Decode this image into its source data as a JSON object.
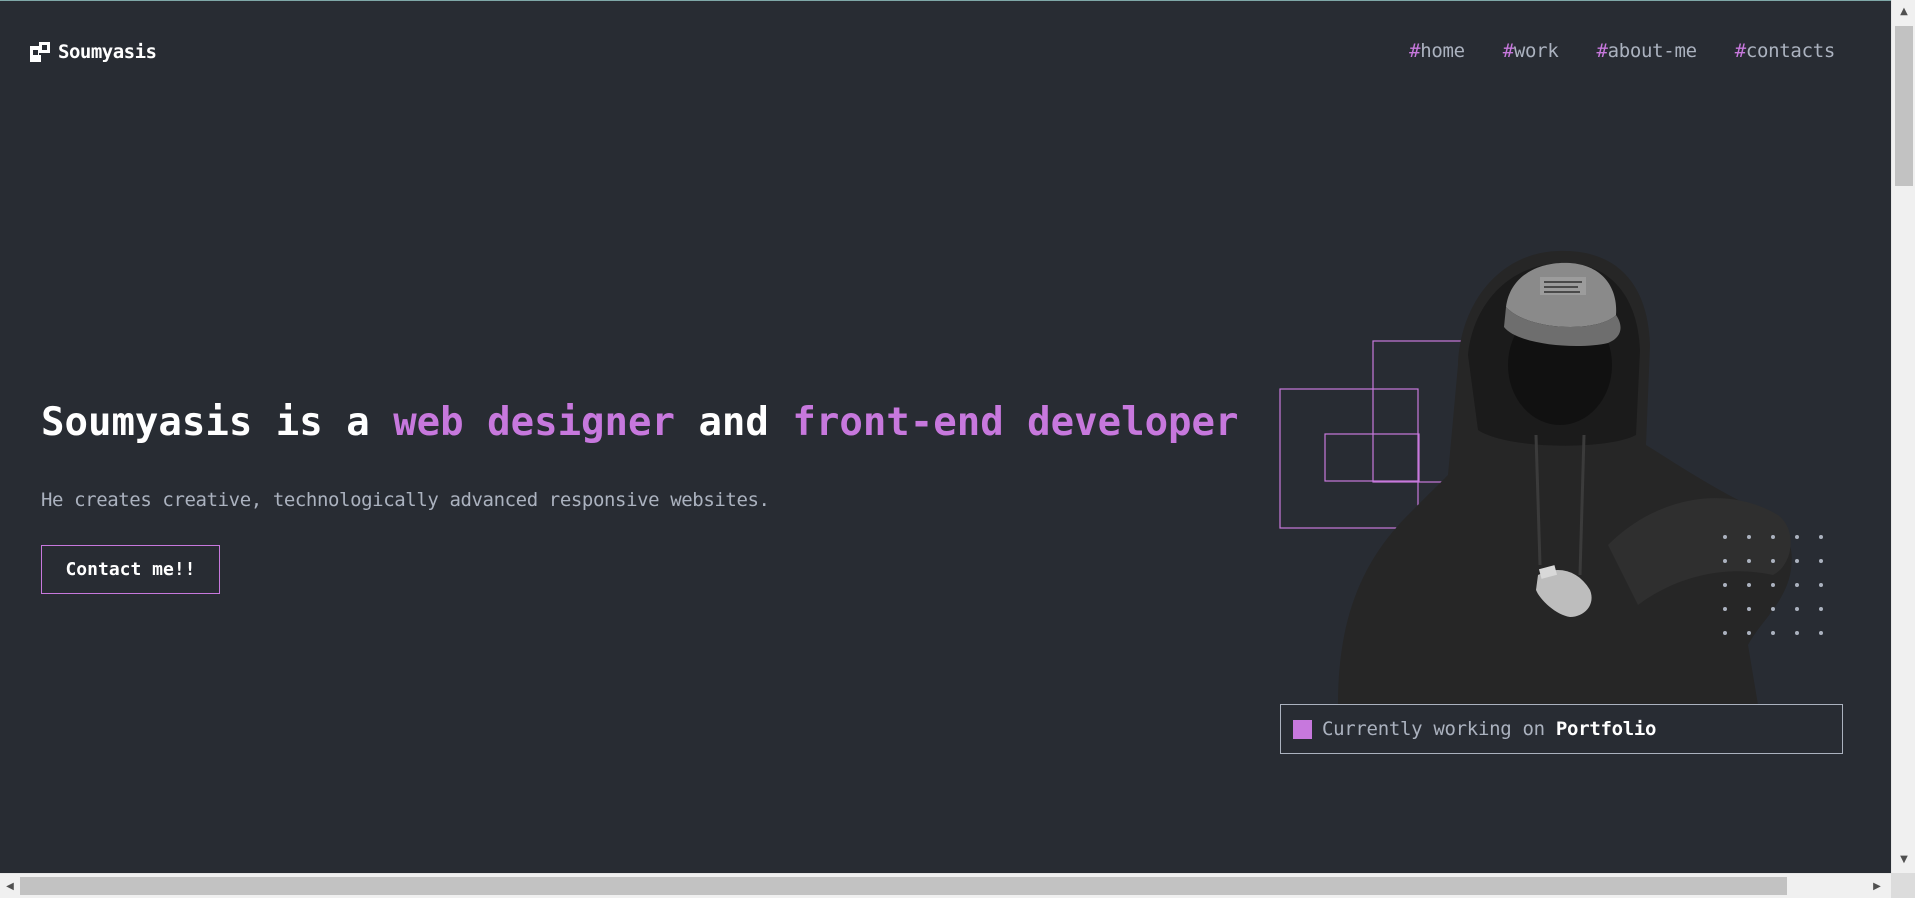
{
  "header": {
    "logo_text": "Soumyasis",
    "nav": [
      {
        "hash": "#",
        "label": "home"
      },
      {
        "hash": "#",
        "label": "work"
      },
      {
        "hash": "#",
        "label": "about-me"
      },
      {
        "hash": "#",
        "label": "contacts"
      }
    ]
  },
  "hero": {
    "title_part1": "Soumyasis is a ",
    "title_accent1": "web designer",
    "title_part2": " and ",
    "title_accent2": "front-end developer",
    "subtitle": "He creates creative, technologically advanced responsive websites.",
    "button_label": "Contact me!!"
  },
  "status": {
    "prefix": "Currently working on ",
    "project": "Portfolio"
  },
  "scrollbars": {
    "up_arrow": "▲",
    "down_arrow": "▼",
    "left_arrow": "◀",
    "right_arrow": "▶"
  },
  "colors": {
    "background": "#282c33",
    "accent": "#c778dd",
    "text_muted": "#abb2bf",
    "text_white": "#ffffff"
  },
  "icons": {
    "logo": "logo-mark-icon",
    "status": "status-square-icon",
    "hero_image": "person-in-hoodie-image"
  }
}
